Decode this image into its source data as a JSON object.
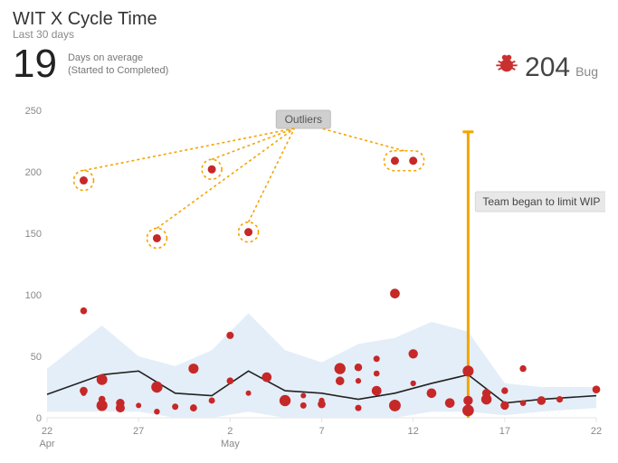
{
  "header": {
    "title": "WIT X Cycle Time",
    "subtitle": "Last 30 days",
    "kpi_value": "19",
    "kpi_caption_line1": "Days on average",
    "kpi_caption_line2": "(Started to Completed)"
  },
  "legend": {
    "count": "204",
    "label": "Bug"
  },
  "annotations": {
    "outliers_label": "Outliers",
    "event_label": "Team began to limit WIP"
  },
  "chart_data": {
    "type": "scatter",
    "xlabel": "",
    "ylabel": "",
    "ylim": [
      0,
      250
    ],
    "x_range_days": [
      0,
      30
    ],
    "y_ticks": [
      0,
      50,
      100,
      150,
      200,
      250
    ],
    "x_ticks": [
      {
        "day": 0,
        "label": "22",
        "month": "Apr"
      },
      {
        "day": 5,
        "label": "27",
        "month": ""
      },
      {
        "day": 10,
        "label": "2",
        "month": "May"
      },
      {
        "day": 15,
        "label": "7",
        "month": ""
      },
      {
        "day": 20,
        "label": "12",
        "month": ""
      },
      {
        "day": 25,
        "label": "17",
        "month": ""
      },
      {
        "day": 30,
        "label": "22",
        "month": ""
      }
    ],
    "event_marker_day": 23,
    "outlier_points": [
      {
        "day": 2,
        "value": 193
      },
      {
        "day": 6,
        "value": 146
      },
      {
        "day": 9,
        "value": 202
      },
      {
        "day": 11,
        "value": 151
      },
      {
        "day": 19,
        "value": 209
      },
      {
        "day": 20,
        "value": 209
      }
    ],
    "scatter_points": [
      {
        "day": 2,
        "value": 87
      },
      {
        "day": 2,
        "value": 20
      },
      {
        "day": 2,
        "value": 22
      },
      {
        "day": 3,
        "value": 15
      },
      {
        "day": 3,
        "value": 31
      },
      {
        "day": 3,
        "value": 10
      },
      {
        "day": 4,
        "value": 12
      },
      {
        "day": 4,
        "value": 8
      },
      {
        "day": 5,
        "value": 10
      },
      {
        "day": 6,
        "value": 25
      },
      {
        "day": 6,
        "value": 5
      },
      {
        "day": 7,
        "value": 9
      },
      {
        "day": 8,
        "value": 8
      },
      {
        "day": 8,
        "value": 40
      },
      {
        "day": 9,
        "value": 14
      },
      {
        "day": 10,
        "value": 30
      },
      {
        "day": 10,
        "value": 67
      },
      {
        "day": 11,
        "value": 20
      },
      {
        "day": 12,
        "value": 33
      },
      {
        "day": 13,
        "value": 14
      },
      {
        "day": 14,
        "value": 10
      },
      {
        "day": 14,
        "value": 18
      },
      {
        "day": 15,
        "value": 11
      },
      {
        "day": 15,
        "value": 14
      },
      {
        "day": 16,
        "value": 30
      },
      {
        "day": 16,
        "value": 40
      },
      {
        "day": 17,
        "value": 8
      },
      {
        "day": 17,
        "value": 30
      },
      {
        "day": 17,
        "value": 41
      },
      {
        "day": 18,
        "value": 36
      },
      {
        "day": 18,
        "value": 48
      },
      {
        "day": 18,
        "value": 22
      },
      {
        "day": 19,
        "value": 101
      },
      {
        "day": 19,
        "value": 10
      },
      {
        "day": 20,
        "value": 52
      },
      {
        "day": 20,
        "value": 28
      },
      {
        "day": 21,
        "value": 20
      },
      {
        "day": 22,
        "value": 12
      },
      {
        "day": 23,
        "value": 14
      },
      {
        "day": 23,
        "value": 38
      },
      {
        "day": 23,
        "value": 6
      },
      {
        "day": 24,
        "value": 15
      },
      {
        "day": 24,
        "value": 20
      },
      {
        "day": 25,
        "value": 10
      },
      {
        "day": 25,
        "value": 22
      },
      {
        "day": 26,
        "value": 40
      },
      {
        "day": 26,
        "value": 12
      },
      {
        "day": 27,
        "value": 14
      },
      {
        "day": 28,
        "value": 15
      },
      {
        "day": 30,
        "value": 23
      }
    ],
    "trend_line": [
      {
        "day": 0,
        "value": 19
      },
      {
        "day": 3,
        "value": 35
      },
      {
        "day": 5,
        "value": 38
      },
      {
        "day": 7,
        "value": 20
      },
      {
        "day": 9,
        "value": 18
      },
      {
        "day": 11,
        "value": 38
      },
      {
        "day": 13,
        "value": 22
      },
      {
        "day": 15,
        "value": 20
      },
      {
        "day": 17,
        "value": 15
      },
      {
        "day": 19,
        "value": 20
      },
      {
        "day": 21,
        "value": 28
      },
      {
        "day": 23,
        "value": 35
      },
      {
        "day": 25,
        "value": 12
      },
      {
        "day": 27,
        "value": 15
      },
      {
        "day": 30,
        "value": 18
      }
    ],
    "band_upper": [
      {
        "day": 0,
        "value": 40
      },
      {
        "day": 3,
        "value": 75
      },
      {
        "day": 5,
        "value": 50
      },
      {
        "day": 7,
        "value": 42
      },
      {
        "day": 9,
        "value": 55
      },
      {
        "day": 11,
        "value": 85
      },
      {
        "day": 13,
        "value": 55
      },
      {
        "day": 15,
        "value": 45
      },
      {
        "day": 17,
        "value": 60
      },
      {
        "day": 19,
        "value": 65
      },
      {
        "day": 21,
        "value": 78
      },
      {
        "day": 23,
        "value": 70
      },
      {
        "day": 25,
        "value": 28
      },
      {
        "day": 27,
        "value": 25
      },
      {
        "day": 30,
        "value": 25
      }
    ],
    "band_lower": [
      {
        "day": 0,
        "value": 5
      },
      {
        "day": 3,
        "value": 5
      },
      {
        "day": 5,
        "value": 5
      },
      {
        "day": 7,
        "value": 0
      },
      {
        "day": 9,
        "value": 0
      },
      {
        "day": 11,
        "value": 5
      },
      {
        "day": 13,
        "value": 0
      },
      {
        "day": 15,
        "value": 0
      },
      {
        "day": 17,
        "value": 0
      },
      {
        "day": 19,
        "value": 0
      },
      {
        "day": 21,
        "value": 5
      },
      {
        "day": 23,
        "value": 5
      },
      {
        "day": 25,
        "value": 2
      },
      {
        "day": 27,
        "value": 5
      },
      {
        "day": 30,
        "value": 8
      }
    ]
  }
}
